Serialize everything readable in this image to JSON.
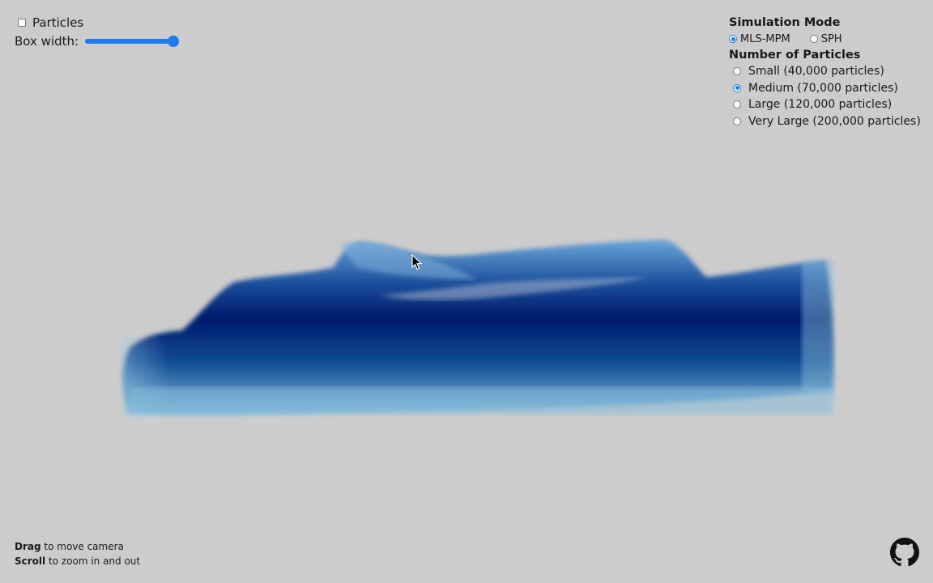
{
  "controls": {
    "particles_label": "Particles",
    "particles_checked": false,
    "box_width_label": "Box width:",
    "box_width_value": 1.0
  },
  "simulation_mode": {
    "heading": "Simulation Mode",
    "options": [
      {
        "label": "MLS-MPM",
        "selected": true
      },
      {
        "label": "SPH",
        "selected": false
      }
    ]
  },
  "particle_count": {
    "heading": "Number of Particles",
    "options": [
      {
        "label": "Small (40,000 particles)",
        "selected": false
      },
      {
        "label": "Medium (70,000 particles)",
        "selected": true
      },
      {
        "label": "Large (120,000 particles)",
        "selected": false
      },
      {
        "label": "Very Large (200,000 particles)",
        "selected": false
      }
    ]
  },
  "help": {
    "drag_key": "Drag",
    "drag_text": " to move camera",
    "scroll_key": "Scroll",
    "scroll_text": " to zoom in and out"
  },
  "icons": {
    "github": "github-icon",
    "cursor": "pointer-cursor-icon"
  },
  "colors": {
    "background": "#cccccc",
    "accent": "#1a7cf0",
    "water_deep": "#001a6b",
    "water_edge": "#6aa9cf"
  }
}
